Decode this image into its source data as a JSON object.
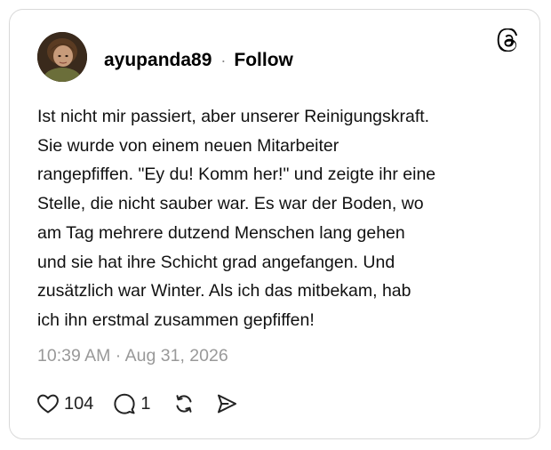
{
  "post": {
    "username": "ayupanda89",
    "separator": "·",
    "follow_label": "Follow",
    "text": "Ist nicht mir passiert, aber unserer Reinigungskraft.\nSie wurde von einem neuen Mitarbeiter\nrangepfiffen. \"Ey du! Komm her!\" und zeigte ihr eine\nStelle, die nicht sauber war. Es war der Boden, wo\nam Tag mehrere dutzend Menschen lang gehen\nund sie hat ihre Schicht grad angefangen. Und\nzusätzlich war Winter. Als ich das mitbekam, hab\nich ihn erstmal zusammen gepfiffen!",
    "timestamp": "10:39 AM · Aug 31, 2026",
    "likes": "104",
    "replies": "1"
  },
  "icons": {
    "brand": "threads-logo-icon",
    "like": "heart-icon",
    "reply": "comment-icon",
    "repost": "repost-icon",
    "share": "send-icon"
  },
  "colors": {
    "text": "#000000",
    "muted": "#999999",
    "border": "#d9d9d9",
    "background": "#ffffff"
  }
}
